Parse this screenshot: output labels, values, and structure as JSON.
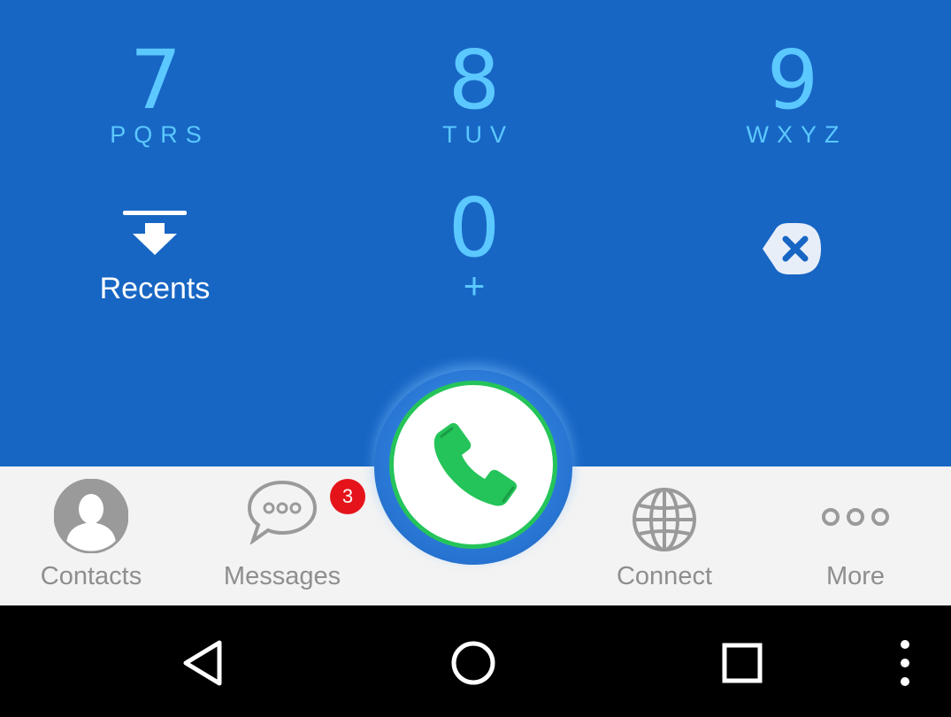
{
  "keypad": {
    "keys": [
      {
        "digit": "7",
        "letters": "PQRS"
      },
      {
        "digit": "8",
        "letters": "TUV"
      },
      {
        "digit": "9",
        "letters": "WXYZ"
      },
      {
        "digit": "0",
        "letters": "+"
      }
    ],
    "recents_label": "Recents",
    "backspace_icon": "backspace-icon"
  },
  "call_button": {
    "icon": "phone-icon",
    "color": "#25c45a"
  },
  "tabs": [
    {
      "label": "Contacts",
      "icon": "person-icon"
    },
    {
      "label": "Messages",
      "icon": "chat-bubble-icon",
      "badge": "3"
    },
    {
      "label": "Connect",
      "icon": "globe-icon"
    },
    {
      "label": "More",
      "icon": "more-dots-icon"
    }
  ],
  "navbar": {
    "buttons": [
      "back-icon",
      "home-icon",
      "recent-apps-icon",
      "overflow-menu-icon"
    ]
  },
  "colors": {
    "keypad_bg": "#1766c4",
    "digit": "#5bc8ff",
    "tabbar_bg": "#f3f3f3",
    "badge": "#e5141a"
  }
}
